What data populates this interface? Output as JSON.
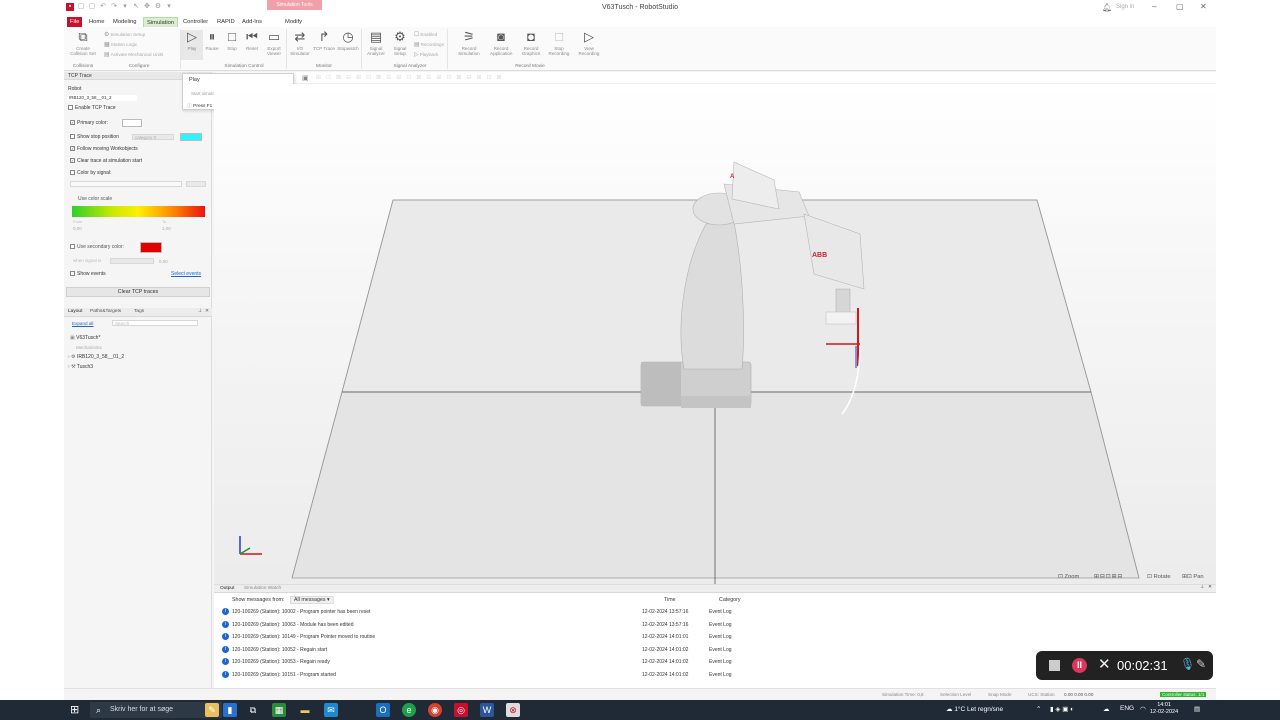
{
  "window": {
    "title": "V63Tusch - RobotStudio",
    "signin": "Sign in"
  },
  "menu_tabs": [
    "File",
    "Home",
    "Modeling",
    "Simulation",
    "Controller",
    "RAPID",
    "Add-Ins",
    "Modify"
  ],
  "contextual_tab": "Simulation Tools",
  "ribbon": {
    "create_collision_set": "Create Collision Set",
    "simulation_setup": "Simulation Setup",
    "station_logic": "Station Logic",
    "activate_mechanical": "Activate Mechanical Units",
    "play": "Play",
    "pause": "Pause",
    "stop": "Stop",
    "reset": "Reset",
    "export_viewer": "Export Viewer",
    "io_simulator": "I/O Simulator",
    "tcp_trace": "TCP Trace",
    "stopwatch": "Stopwatch",
    "signal_analyzer": "Signal Analyzer",
    "signal_setup": "Signal Setup",
    "enabled": "Enabled",
    "recordings": "Recordings",
    "playback": "Playback",
    "record_simulation": "Record Simulation",
    "record_application": "Record Application",
    "record_graphics": "Record Graphics",
    "stop_recording": "Stop Recording",
    "view_recording": "View Recording",
    "groups": [
      "Collisions",
      "Configure",
      "Simulation Control",
      "Monitor",
      "Signal Analyzer",
      "Record Movie"
    ]
  },
  "tooltip": {
    "title": "Play",
    "desc": "Start simulation",
    "help": "Press F1 for more help."
  },
  "tcp_panel": {
    "header": "TCP Trace",
    "robot_label": "Robot",
    "robot_value": "IRB120_3_58__01_2",
    "enable_trace": "Enable TCP Trace",
    "primary_color": "Primary color:",
    "show_stop_position": "Show stop position",
    "category_placeholder": "category 0",
    "follow_workobjects": "Follow moving Workobjects",
    "clear_at_start": "Clear trace at simulation start",
    "color_by_signal": "Color by signal:",
    "use_color_scale": "Use color scale",
    "from_label": "From",
    "to_label": "To",
    "from_value": "0,00",
    "to_value": "1,00",
    "use_secondary_color": "Use secondary color:",
    "when_signal_is": "when signal is",
    "when_value": "0,00",
    "show_events": "Show events",
    "select_events": "Select events",
    "clear_btn": "Clear TCP traces",
    "primary_hex": "#ffffff",
    "stop_hex": "#2ff2ff",
    "secondary_hex": "#e00000"
  },
  "layout_panel": {
    "tabs": [
      "Layout",
      "Paths&Targets",
      "Tags"
    ],
    "expand_all": "Expand all",
    "search": "Search",
    "station": "V63Tusch*",
    "mechanisms": "Mechanisms",
    "robot": "IRB120_3_58__01_2",
    "tool": "Tusch3"
  },
  "viewport": {
    "zoom": "Zoom",
    "rotate": "Rotate",
    "pan": "Pan"
  },
  "output": {
    "tabs": [
      "Output",
      "Simulation Watch"
    ],
    "show_from": "Show messages from:",
    "filter": "All messages",
    "col_time": "Time",
    "col_category": "Category",
    "rows": [
      {
        "msg": "120-100269 (Station): 10002 - Program pointer has been reset",
        "time": "12-02-2024 13:57:16",
        "cat": "Event Log"
      },
      {
        "msg": "120-100269 (Station): 10063 - Module has been edited",
        "time": "12-02-2024 13:57:16",
        "cat": "Event Log"
      },
      {
        "msg": "120-100269 (Station): 10149 - Program Pointer moved to routine",
        "time": "12-02-2024 14:01:01",
        "cat": "Event Log"
      },
      {
        "msg": "120-100269 (Station): 10052 - Regain start",
        "time": "12-02-2024 14:01:02",
        "cat": "Event Log"
      },
      {
        "msg": "120-100269 (Station): 10053 - Regain ready",
        "time": "12-02-2024 14:01:02",
        "cat": "Event Log"
      },
      {
        "msg": "120-100269 (Station): 10151 - Program started",
        "time": "12-02-2024 14:01:02",
        "cat": "Event Log"
      }
    ]
  },
  "statusbar": {
    "sim_time": "Simulation Time: 0,8",
    "selection": "Selection Level",
    "snap": "Snap Mode",
    "ucs": "UCS: Station",
    "coords": "0.00 0.00 0.00",
    "controller": "Controller status: 1/1"
  },
  "recorder": {
    "time": "00:02:31"
  },
  "taskbar": {
    "search": "Skriv her for at søge",
    "weather": "1°C  Let regn/sne",
    "lang": "ENG",
    "time": "14:01",
    "date": "12-02-2024"
  }
}
